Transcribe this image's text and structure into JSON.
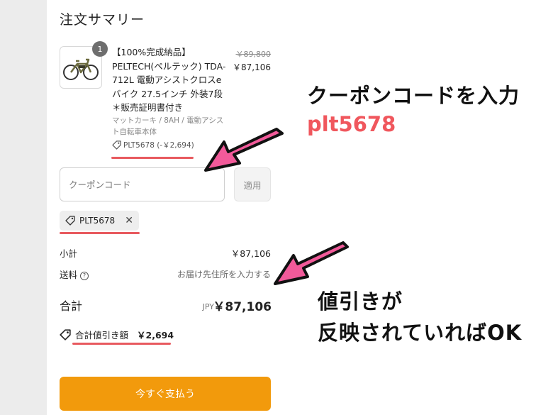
{
  "summary": {
    "title": "注文サマリー",
    "quantity": "1",
    "product_name": "【100%完成納品】PELTECH(ペルテック) TDA-712L 電動アシストクロスeバイク 27.5インチ 外装7段＊販売証明書付き",
    "variant": "マットカーキ / 8AH / 電動アシスト自転車本体",
    "discount_code_line": "PLT5678 (-￥2,694)",
    "original_price": "￥89,800",
    "current_price": "￥87,106"
  },
  "coupon": {
    "placeholder": "クーポンコード",
    "apply_label": "適用",
    "applied_chip": "PLT5678"
  },
  "totals": {
    "subtotal_label": "小計",
    "subtotal_value": "￥87,106",
    "shipping_label": "送料",
    "shipping_value": "お届け先住所を入力する",
    "total_label": "合計",
    "currency": "JPY",
    "total_value": "￥87,106",
    "savings_label": "合計値引き額",
    "savings_value": "￥2,694"
  },
  "pay_button": "今すぐ支払う",
  "annotations": {
    "line1": "クーポンコードを入力",
    "code": "plt5678",
    "line2": "値引きが",
    "line3": "反映されていればOK"
  },
  "colors": {
    "accent_orange": "#f29a0c",
    "highlight_red": "#e85a5f",
    "arrow_pink": "#f25a9a",
    "code_red": "#f0575d"
  },
  "icons": [
    "bicycle-image",
    "tag-icon",
    "close-icon",
    "help-icon",
    "arrow-pointer"
  ]
}
